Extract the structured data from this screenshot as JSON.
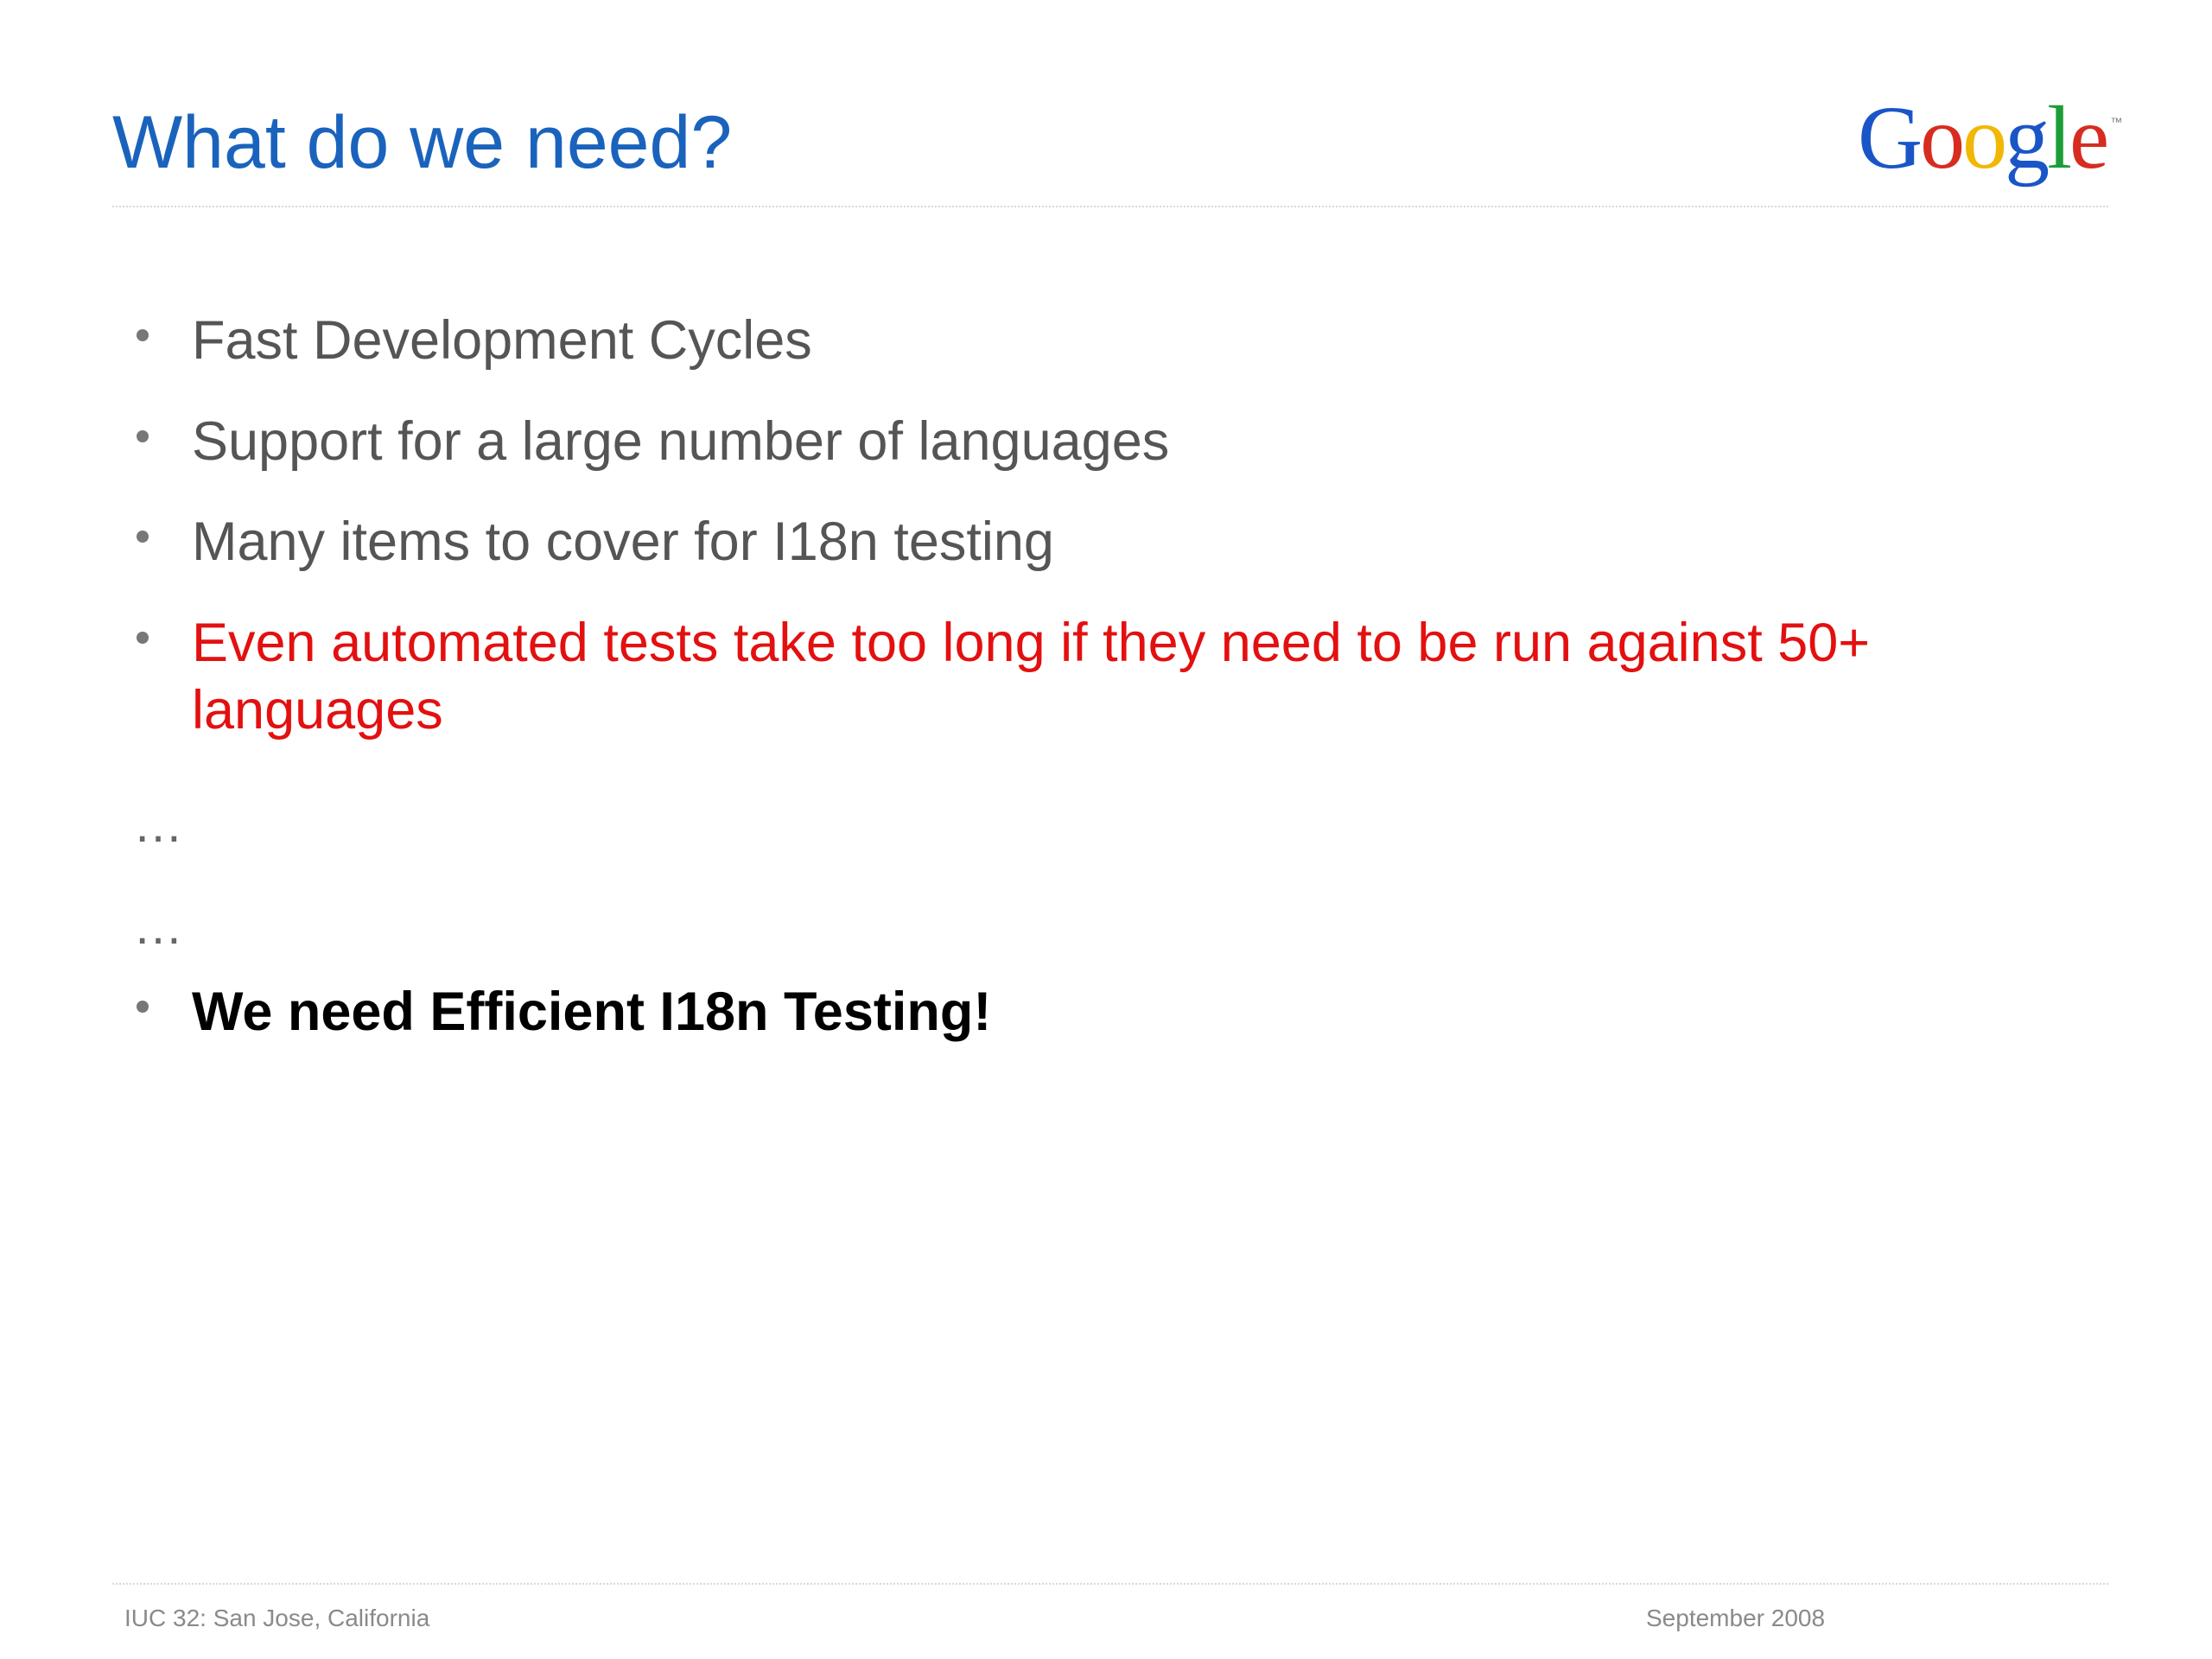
{
  "slide": {
    "title": "What do we need?",
    "logo": {
      "letters": [
        "G",
        "o",
        "o",
        "g",
        "l",
        "e"
      ],
      "colors": [
        "#1a55c8",
        "#d62d20",
        "#f2b705",
        "#1a55c8",
        "#1b9e3a",
        "#d62d20"
      ],
      "trademark": "™"
    },
    "bullets": [
      {
        "text": "Fast Development Cycles",
        "style": "normal",
        "color": "#555555"
      },
      {
        "text": "Support for a large number of languages",
        "style": "normal",
        "color": "#555555"
      },
      {
        "text": "Many items to cover for I18n testing",
        "style": "normal",
        "color": "#555555"
      },
      {
        "text": "Even automated tests take too long if they need to be run against 50+ languages",
        "style": "highlight",
        "color": "#e31010"
      }
    ],
    "ellipses": [
      "…",
      "…"
    ],
    "conclusion": {
      "text": "We need Efficient I18n Testing!",
      "style": "bold",
      "color": "#000000"
    },
    "footer": {
      "left": "IUC 32: San Jose, California",
      "right": "September 2008"
    },
    "colors": {
      "title": "#1a63bd",
      "body": "#555555",
      "highlight": "#e31010"
    }
  }
}
